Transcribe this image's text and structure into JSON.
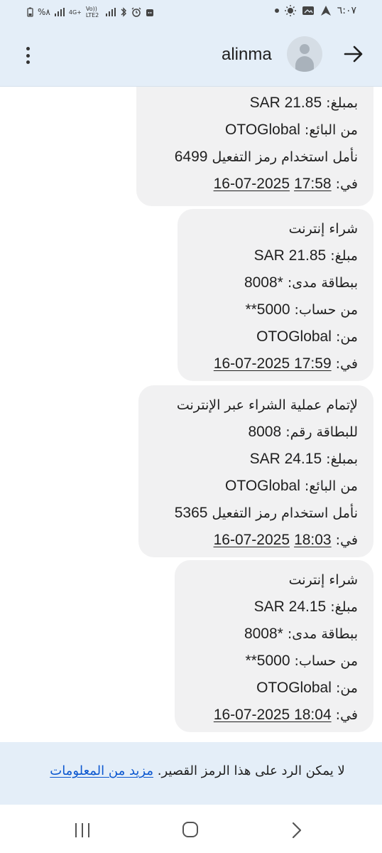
{
  "status_bar": {
    "time": "٦:٠٧",
    "battery": "%٨",
    "network_type": "4G+",
    "volte": "Vo)) LTE2",
    "icons": [
      "battery-icon",
      "signal-icon",
      "4g-icon",
      "volte-icon",
      "signal-icon",
      "bluetooth-icon",
      "alarm-icon",
      "app-notification-icon",
      "dot-icon",
      "brightness-icon",
      "gallery-icon",
      "navigation-icon"
    ]
  },
  "app_bar": {
    "title": "alinma",
    "menu_icon": "more-vert-icon",
    "back_icon": "arrow-right-icon",
    "avatar_icon": "person-icon"
  },
  "messages": [
    {
      "lines": [
        [
          {
            "t": "بمبلغ: "
          },
          {
            "t": "SAR 21.85",
            "n": true
          }
        ],
        [
          {
            "t": "من البائع: "
          },
          {
            "t": "OTOGlobal",
            "n": true
          }
        ],
        [
          {
            "t": "نأمل استخدام رمز التفعيل "
          },
          {
            "t": "6499",
            "n": true
          }
        ],
        [
          {
            "t": "في: "
          },
          {
            "t": "17:58",
            "n": true,
            "u": true
          },
          {
            "t": " "
          },
          {
            "t": "16-07-2025",
            "n": true,
            "u": true
          }
        ]
      ]
    },
    {
      "lines": [
        [
          {
            "t": "شراء إنترنت"
          }
        ],
        [
          {
            "t": "مبلغ: "
          },
          {
            "t": "SAR 21.85",
            "n": true
          }
        ],
        [
          {
            "t": "ببطاقة مدى: "
          },
          {
            "t": "8008*",
            "n": true
          }
        ],
        [
          {
            "t": "من حساب: "
          },
          {
            "t": "**5000",
            "n": true
          }
        ],
        [
          {
            "t": "من: "
          },
          {
            "t": "OTOGlobal",
            "n": true
          }
        ],
        [
          {
            "t": "في: "
          },
          {
            "t": "16-07-2025 17:59",
            "n": true,
            "u": true
          }
        ]
      ]
    },
    {
      "lines": [
        [
          {
            "t": "لإتمام عملية الشراء عبر الإنترنت"
          }
        ],
        [
          {
            "t": "للبطاقة رقم: "
          },
          {
            "t": "8008",
            "n": true
          }
        ],
        [
          {
            "t": "بمبلغ: "
          },
          {
            "t": "SAR 24.15",
            "n": true
          }
        ],
        [
          {
            "t": "من البائع: "
          },
          {
            "t": "OTOGlobal",
            "n": true
          }
        ],
        [
          {
            "t": "نأمل استخدام رمز التفعيل "
          },
          {
            "t": "5365",
            "n": true
          }
        ],
        [
          {
            "t": "في: "
          },
          {
            "t": "18:03",
            "n": true,
            "u": true
          },
          {
            "t": " "
          },
          {
            "t": "16-07-2025",
            "n": true,
            "u": true
          }
        ]
      ]
    },
    {
      "lines": [
        [
          {
            "t": "شراء إنترنت"
          }
        ],
        [
          {
            "t": "مبلغ: "
          },
          {
            "t": "SAR 24.15",
            "n": true
          }
        ],
        [
          {
            "t": "ببطاقة مدى: "
          },
          {
            "t": "8008*",
            "n": true
          }
        ],
        [
          {
            "t": "من حساب: "
          },
          {
            "t": "**5000",
            "n": true
          }
        ],
        [
          {
            "t": "من: "
          },
          {
            "t": "OTOGlobal",
            "n": true
          }
        ],
        [
          {
            "t": "في: "
          },
          {
            "t": "16-07-2025 18:04",
            "n": true,
            "u": true
          }
        ]
      ]
    }
  ],
  "footer": {
    "text": "لا يمكن الرد على هذا الرمز القصير.",
    "link": "مزيد من المعلومات"
  },
  "nav_bar": {
    "icons": [
      "recents-icon",
      "home-icon",
      "back-icon"
    ]
  }
}
